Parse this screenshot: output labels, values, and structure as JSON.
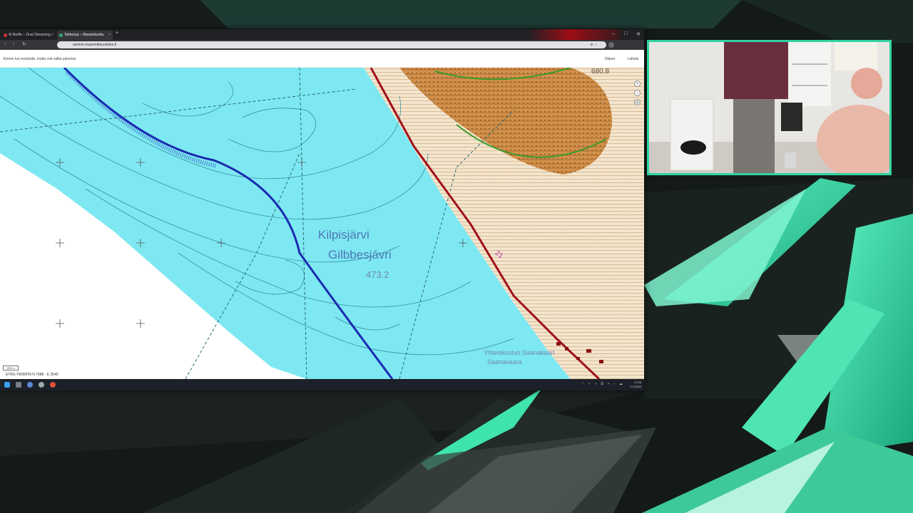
{
  "browser": {
    "tabs": [
      {
        "label": "4) Barfle – Dual Streaming",
        "active": false
      },
      {
        "label": "Tahkorpa – Maastokartta",
        "active": true
      }
    ],
    "new_tab_label": "+",
    "url": "asiointi.maanmittauslaitos.fi",
    "window_controls": {
      "minimize": "–",
      "maximize": "□",
      "close": "✕"
    },
    "nav": {
      "back": "‹",
      "forward": "›",
      "reload": "↻"
    }
  },
  "page": {
    "notice": "Emme luo evästeitä, mutta voit valita palvelun",
    "header_links": [
      "Ohjeet",
      "Lahetä"
    ]
  },
  "map": {
    "lake_name_fi": "Kilpisjärvi",
    "lake_name_se": "Gilbbesjávri",
    "lake_altitude": "473.2",
    "peak_altitude": "680.8",
    "road_number": "21",
    "place_line1": "Yhteiskoulun Saanakaari",
    "place_line2": "Saanavaara",
    "scale_label": "200 m",
    "coordinates": "ETRS-TM35FIN    N 7688 · E 2540",
    "tools": [
      "+",
      "–",
      "◎"
    ]
  },
  "taskbar": {
    "tray_text": "⌃ ◐ ◑ ☰ ⌁ ♪ ☁",
    "time": "17:26",
    "date": "2.2.2024"
  },
  "colors": {
    "lake": "#7de8f2",
    "contour": "#3a8fa0",
    "road": "#a0101a",
    "border": "#1a2bb0",
    "terrain": "#c8873a",
    "cam_border": "#2fd3a0",
    "bg_accent": "#2fe0a8"
  }
}
